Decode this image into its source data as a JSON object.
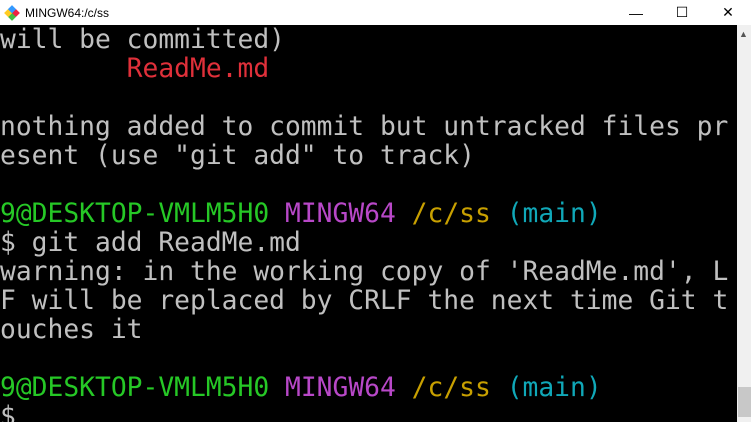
{
  "window": {
    "title": "MINGW64:/c/ss",
    "minimize": "—",
    "maximize": "☐",
    "close": "✕"
  },
  "colors": {
    "text": "#c0c0c0",
    "untracked": "#e0303a",
    "user": "#26c826",
    "shell": "#b848c8",
    "path": "#c8a000",
    "branch": "#10a8b8"
  },
  "terminal": {
    "l0": "will be committed)",
    "l1": "        ReadMe.md",
    "l3": "nothing added to commit but untracked files pr",
    "l4": "esent (use \"git add\" to track)",
    "prompt": {
      "user": "9@DESKTOP-VMLM5H0",
      "shell": "MINGW64",
      "path": "/c/ss",
      "branch": "(main)"
    },
    "l7": "$ git add ReadMe.md",
    "l8": "warning: in the working copy of 'ReadMe.md', L",
    "l9": "F will be replaced by CRLF the next time Git t",
    "l10": "ouches it",
    "l13": "$"
  }
}
